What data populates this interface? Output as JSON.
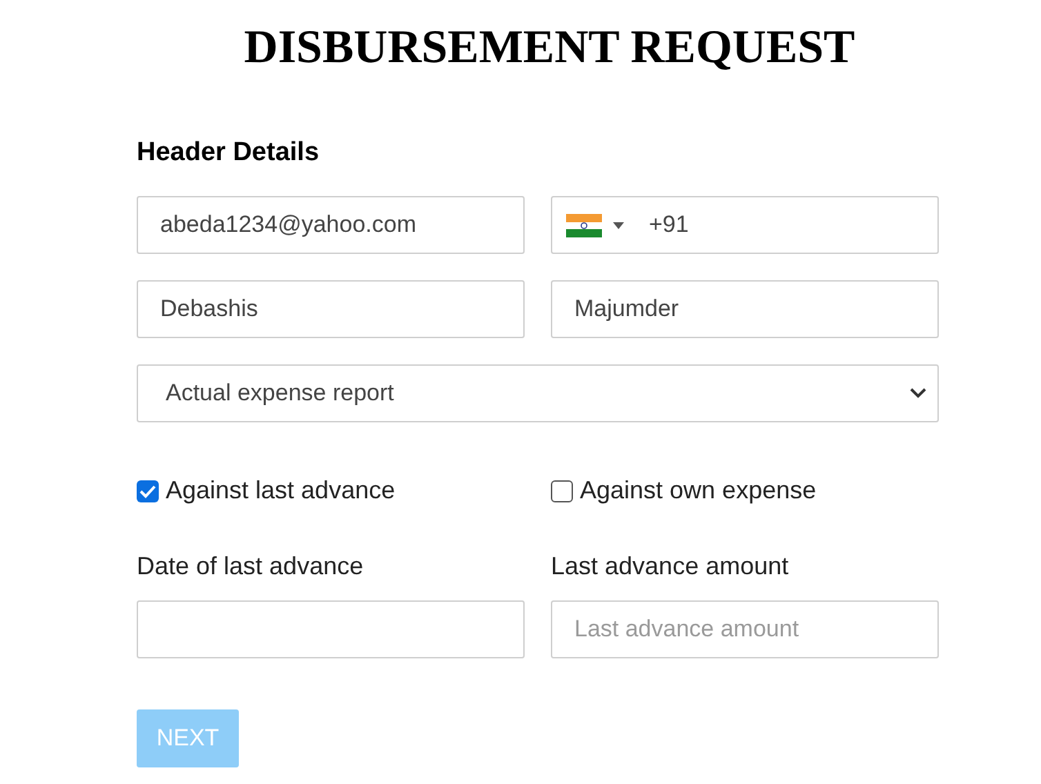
{
  "title": "DISBURSEMENT REQUEST",
  "section_heading": "Header Details",
  "email": {
    "value": "abeda1234@yahoo.com"
  },
  "phone": {
    "value": "+91"
  },
  "first_name": {
    "value": "Debashis"
  },
  "last_name": {
    "value": "Majumder"
  },
  "report_type": {
    "value": "Actual expense report"
  },
  "options": [
    {
      "label": "Against last advance",
      "checked": true
    },
    {
      "label": "Against own expense",
      "checked": false
    }
  ],
  "fields": [
    {
      "label": "Date of last advance"
    },
    {
      "label": "Last advance amount",
      "placeholder": "Last advance amount"
    }
  ],
  "next_button": {
    "label": "NEXT",
    "disabled": true
  }
}
